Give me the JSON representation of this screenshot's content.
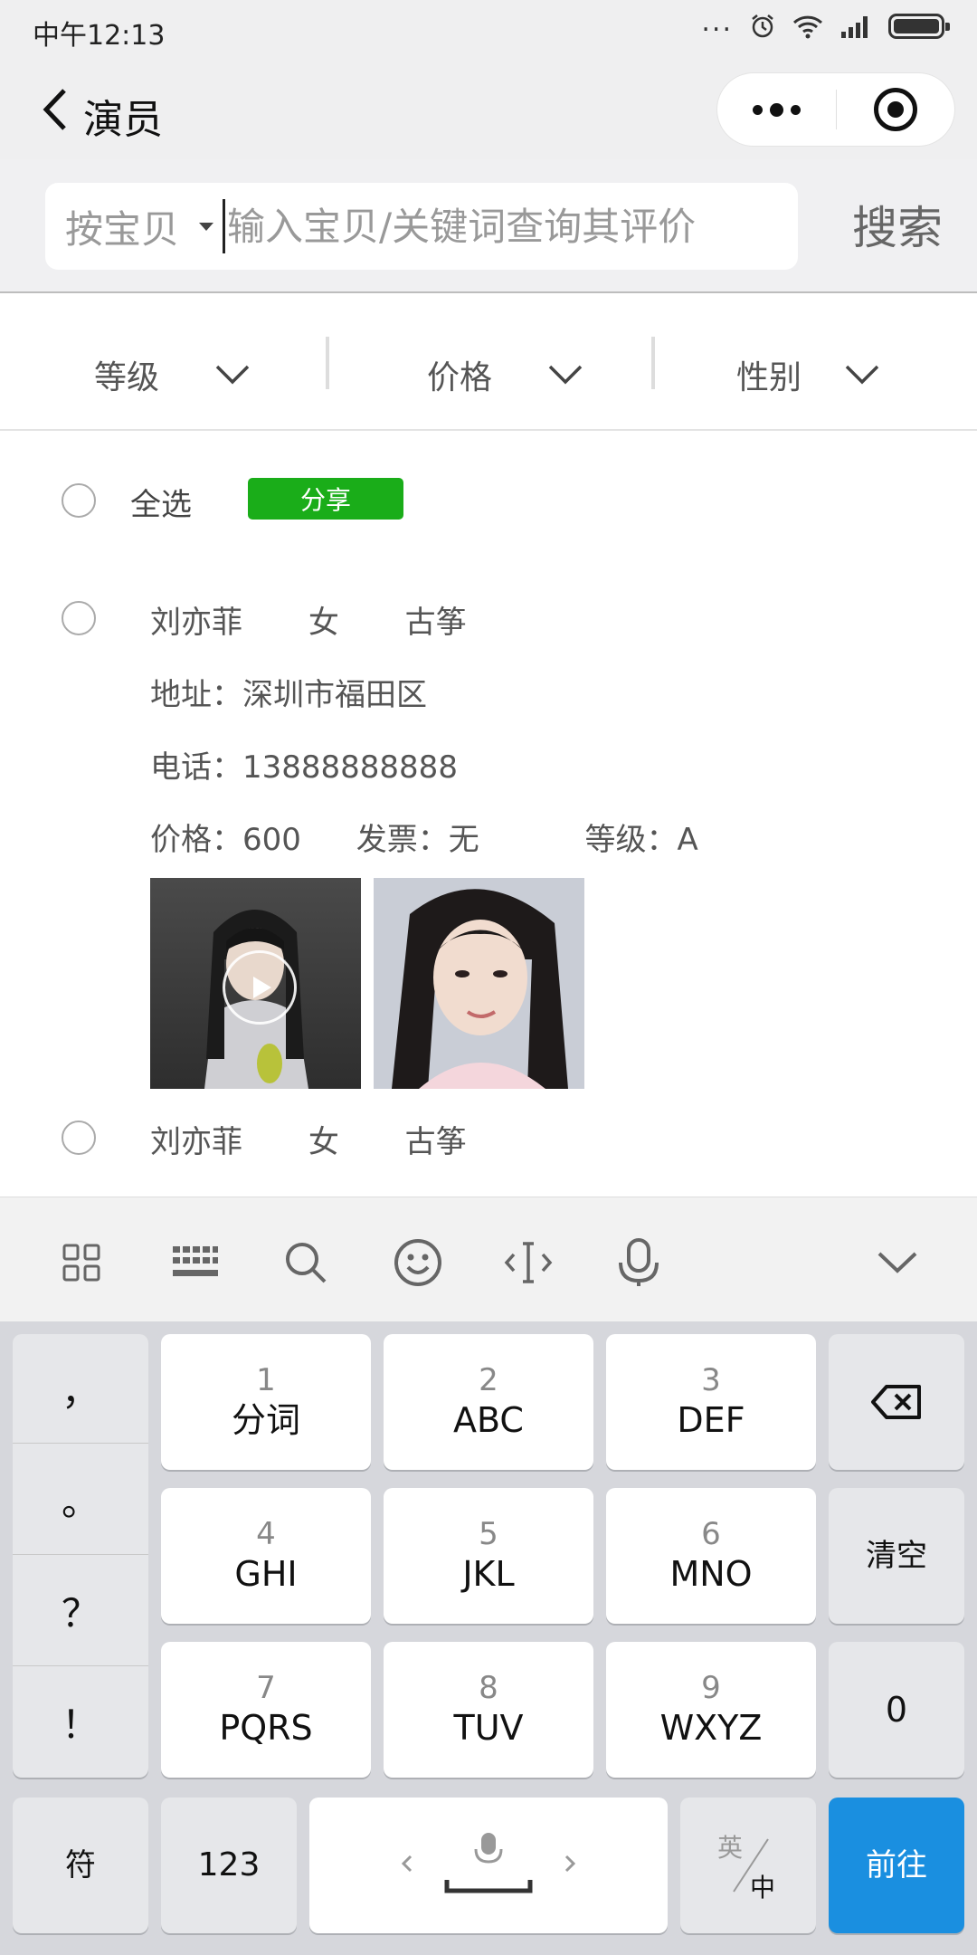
{
  "status_bar": {
    "time": "中午12:13",
    "dots": "..."
  },
  "nav": {
    "title": "演员"
  },
  "search": {
    "type_label": "按宝贝",
    "placeholder": "输入宝贝/关键词查询其评价",
    "button_label": "搜索"
  },
  "filters": [
    {
      "label": "等级"
    },
    {
      "label": "价格"
    },
    {
      "label": "性别"
    }
  ],
  "select_all": {
    "label": "全选",
    "share_label": "分享"
  },
  "actors": [
    {
      "name": "刘亦菲",
      "gender": "女",
      "skill": "古筝",
      "address": "地址：深圳市福田区",
      "phone": "电话：13888888888",
      "price": "价格：600",
      "invoice": "发票：无",
      "level": "等级：A"
    },
    {
      "name": "刘亦菲",
      "gender": "女",
      "skill": "古筝"
    }
  ],
  "keyboard": {
    "punctuation": [
      "，",
      "。",
      "？",
      "！"
    ],
    "keys": [
      {
        "num": "1",
        "label": "分词"
      },
      {
        "num": "2",
        "label": "ABC"
      },
      {
        "num": "3",
        "label": "DEF"
      },
      {
        "num": "4",
        "label": "GHI"
      },
      {
        "num": "5",
        "label": "JKL"
      },
      {
        "num": "6",
        "label": "MNO"
      },
      {
        "num": "7",
        "label": "PQRS"
      },
      {
        "num": "8",
        "label": "TUV"
      },
      {
        "num": "9",
        "label": "WXYZ"
      }
    ],
    "clear_label": "清空",
    "zero_label": "0",
    "symbol_label": "符",
    "numbers_label": "123",
    "lang_en": "英",
    "lang_zh": "中",
    "go_label": "前往"
  },
  "colors": {
    "share_green": "#1aad19",
    "go_blue": "#1a8fe0"
  }
}
